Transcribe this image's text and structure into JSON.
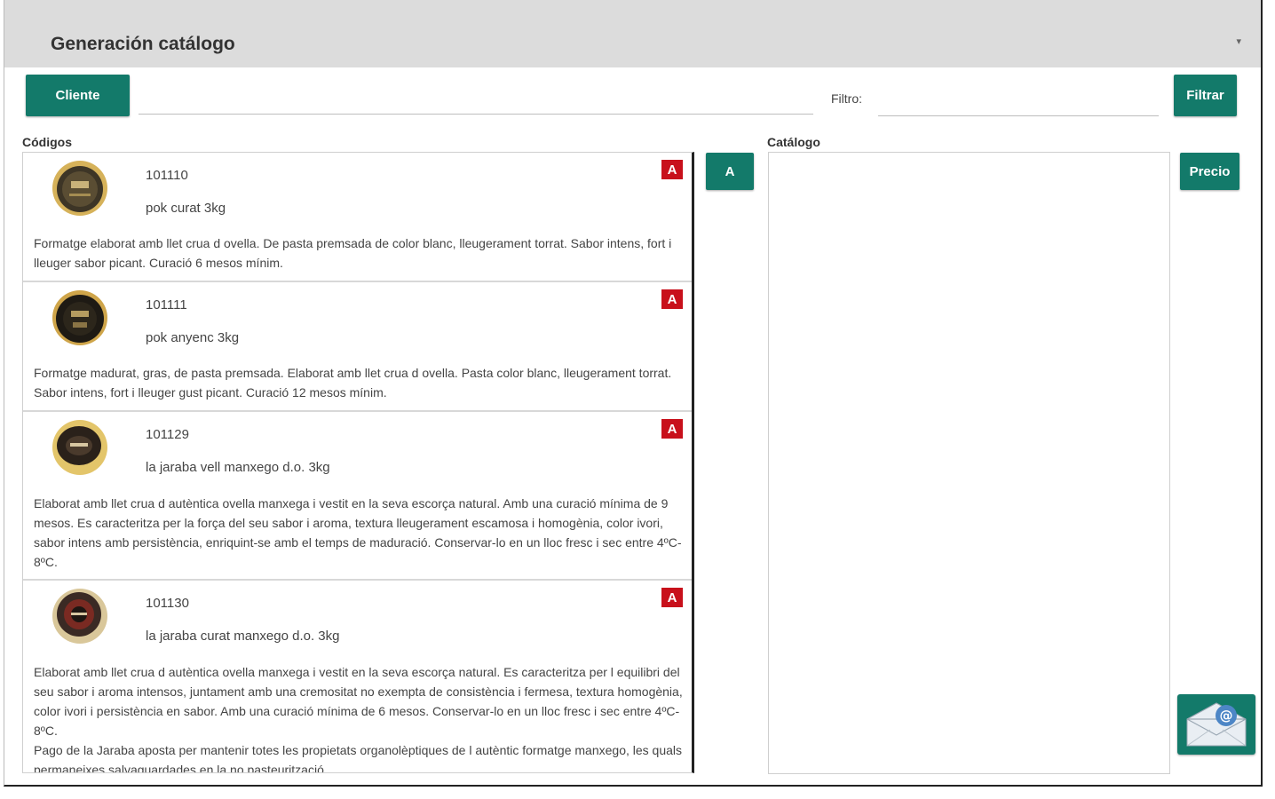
{
  "window": {
    "title": "Generación catálogo",
    "collapse_icon": "minimize-icon"
  },
  "toolbar": {
    "cliente_label": "Cliente",
    "cliente_value": "",
    "filter_label": "Filtro:",
    "filter_value": "",
    "filtrar_label": "Filtrar"
  },
  "codes": {
    "header": "Códigos",
    "add_label": "A",
    "items": [
      {
        "code": "101110",
        "name": "pok curat 3kg",
        "badge": "A",
        "description": "Formatge elaborat amb llet crua d ovella. De pasta premsada de color blanc, lleugerament torrat. Sabor intens, fort i lleuger sabor picant. Curació 6 mesos mínim."
      },
      {
        "code": "101111",
        "name": "pok anyenc 3kg",
        "badge": "A",
        "description": "Formatge madurat, gras, de pasta premsada. Elaborat amb llet crua d ovella. Pasta color blanc, lleugerament torrat. Sabor intens, fort i lleuger gust picant. Curació 12 mesos mínim."
      },
      {
        "code": "101129",
        "name": "la jaraba vell manxego d.o. 3kg",
        "badge": "A",
        "description": "Elaborat amb llet crua d autèntica ovella manxega i vestit en la seva escorça natural. Amb una curació mínima de 9 mesos. Es caracteritza per la força del seu sabor i aroma, textura lleugerament escamosa i homogènia, color ivori, sabor intens amb persistència, enriquint-se amb el temps de maduració. Conservar-lo en un lloc fresc i sec entre 4ºC-8ºC."
      },
      {
        "code": "101130",
        "name": "la jaraba curat manxego d.o. 3kg",
        "badge": "A",
        "description": "Elaborat amb llet crua d autèntica ovella manxega i vestit en la seva escorça natural. Es caracteritza per l equilibri del seu sabor i aroma intensos, juntament amb una cremositat no exempta de consistència i fermesa, textura homogènia, color ivori i persistència en sabor. Amb una curació mínima de 6 mesos. Conservar-lo en un lloc fresc i sec entre 4ºC-8ºC.\nPago de la Jaraba aposta per mantenir totes les propietats organolèptiques de l autèntic formatge manxego, les quals permaneixes salvaguardades en la no pasteurització."
      }
    ]
  },
  "catalog": {
    "header": "Catálogo",
    "price_label": "Precio",
    "send_icon": "email-send-icon"
  },
  "colors": {
    "primary": "#137a6a",
    "badge": "#c8101b",
    "titlebar": "#dcdcdc"
  }
}
